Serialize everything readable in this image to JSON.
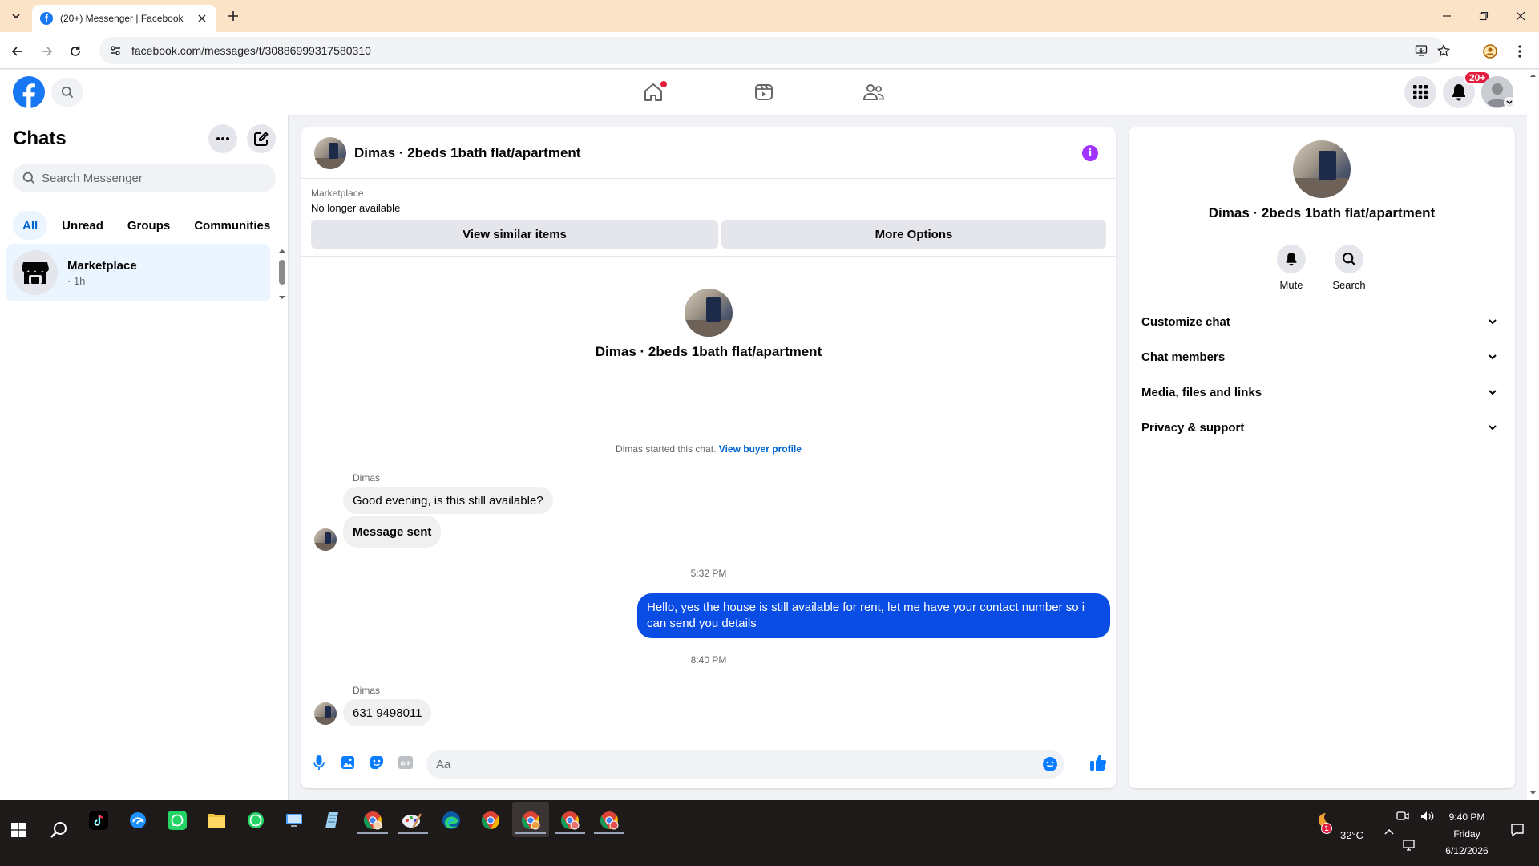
{
  "browser": {
    "tab_title": "(20+) Messenger | Facebook",
    "favicon_letter": "f",
    "url": "facebook.com/messages/t/30886999317580310"
  },
  "fbnav": {
    "notifications_badge": "20+"
  },
  "left": {
    "title": "Chats",
    "search_placeholder": "Search Messenger",
    "filters": [
      "All",
      "Unread",
      "Groups",
      "Communities"
    ],
    "chat_item": {
      "name": "Marketplace",
      "time": "· 1h"
    }
  },
  "conversation": {
    "header_name": "Dimas · 2beds 1bath flat/apartment",
    "marketplace_label": "Marketplace",
    "status": "No longer available",
    "btn_view_similar": "View similar items",
    "btn_more_options": "More Options",
    "center_name": "Dimas · 2beds 1bath flat/apartment",
    "started_text": "Dimas started this chat.",
    "view_buyer_profile": "View buyer profile",
    "sender_1": "Dimas",
    "msg_1": "Good evening, is this still available?",
    "msg_2": "Message sent",
    "time_1": "5:32 PM",
    "msg_out": "Hello, yes the house is still available for rent, let me have your contact number so i can send you details",
    "time_2": "8:40 PM",
    "sender_2": "Dimas",
    "msg_3": "631 9498011",
    "composer_placeholder": "Aa"
  },
  "right": {
    "name": "Dimas · 2beds 1bath flat/apartment",
    "mute_label": "Mute",
    "search_label": "Search",
    "sections": [
      "Customize chat",
      "Chat members",
      "Media, files and links",
      "Privacy & support"
    ]
  },
  "taskbar": {
    "temperature": "32°C",
    "weather_badge": "1",
    "time": "9:40 PM",
    "day": "Friday",
    "date": "6/12/2026"
  },
  "colors": {
    "fb_blue": "#1877f2",
    "outgoing_bubble": "#0a4de5",
    "link": "#0064d1",
    "info_purple": "#a033ff",
    "badge_red": "#e41e3f"
  }
}
